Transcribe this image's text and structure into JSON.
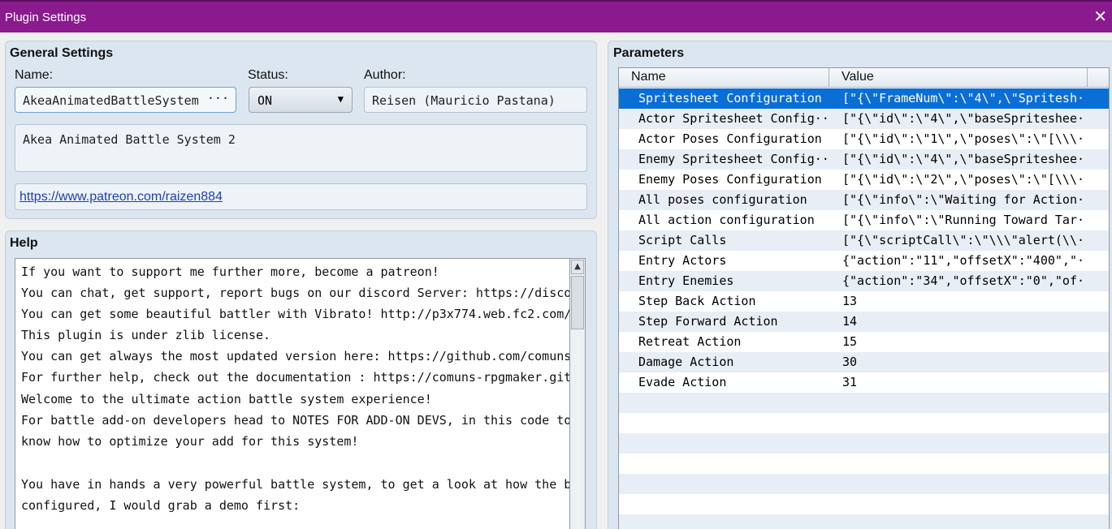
{
  "window": {
    "title": "Plugin Settings",
    "close_glyph": "✕"
  },
  "general": {
    "heading": "General Settings",
    "name_label": "Name:",
    "name_value": "AkeaAnimatedBattleSystem",
    "name_button": "···",
    "status_label": "Status:",
    "status_value": "ON",
    "author_label": "Author:",
    "author_value": "Reisen (Mauricio Pastana)",
    "description": "Akea Animated Battle System 2",
    "url": "https://www.patreon.com/raizen884"
  },
  "help": {
    "heading": "Help",
    "lines": [
      "If you want to support me further more, become a patreon!",
      "You can chat, get support, report bugs on our discord Server: https://discord",
      "You can get some beautiful battler with Vibrato! http://p3x774.web.fc2.com/",
      "This plugin is under zlib license.",
      "You can get always the most updated version here: https://github.com/comuns-r",
      "For further help, check out the documentation : https://comuns-rpgmaker.githu",
      "Welcome to the ultimate action battle system experience!",
      "For battle add-on developers head to NOTES FOR ADD-ON DEVS, in this code to",
      "know how to optimize your add for this system!",
      "",
      "You have in hands a very powerful battle system, to get a look at how the bat",
      "configured, I would grab a demo first:"
    ],
    "scroll_up_glyph": "▲"
  },
  "parameters": {
    "heading": "Parameters",
    "columns": {
      "name": "Name",
      "value": "Value"
    },
    "rows": [
      {
        "name": "Spritesheet Configuration",
        "value": "[\"{\\\"FrameNum\\\":\\\"4\\\",\\\"Spritesh···"
      },
      {
        "name": "Actor Spritesheet Config···",
        "value": "[\"{\\\"id\\\":\\\"4\\\",\\\"baseSpriteshee···"
      },
      {
        "name": "Actor Poses Configuration",
        "value": "[\"{\\\"id\\\":\\\"1\\\",\\\"poses\\\":\\\"[\\\\\\···"
      },
      {
        "name": "Enemy Spritesheet Config···",
        "value": "[\"{\\\"id\\\":\\\"4\\\",\\\"baseSpriteshee···"
      },
      {
        "name": "Enemy Poses Configuration",
        "value": "[\"{\\\"id\\\":\\\"2\\\",\\\"poses\\\":\\\"[\\\\\\···"
      },
      {
        "name": "All poses configuration",
        "value": "[\"{\\\"info\\\":\\\"Waiting for Action···"
      },
      {
        "name": "All action configuration",
        "value": "[\"{\\\"info\\\":\\\"Running Toward Tar···"
      },
      {
        "name": "Script Calls",
        "value": "[\"{\\\"scriptCall\\\":\\\"\\\\\\\"alert(\\\\···"
      },
      {
        "name": "Entry Actors",
        "value": "{\"action\":\"11\",\"offsetX\":\"400\",\"···"
      },
      {
        "name": "Entry Enemies",
        "value": "{\"action\":\"34\",\"offsetX\":\"0\",\"of···"
      },
      {
        "name": "Step Back Action",
        "value": "13"
      },
      {
        "name": "Step Forward Action",
        "value": "14"
      },
      {
        "name": "Retreat Action",
        "value": "15"
      },
      {
        "name": "Damage Action",
        "value": "30"
      },
      {
        "name": "Evade Action",
        "value": "31"
      }
    ]
  }
}
